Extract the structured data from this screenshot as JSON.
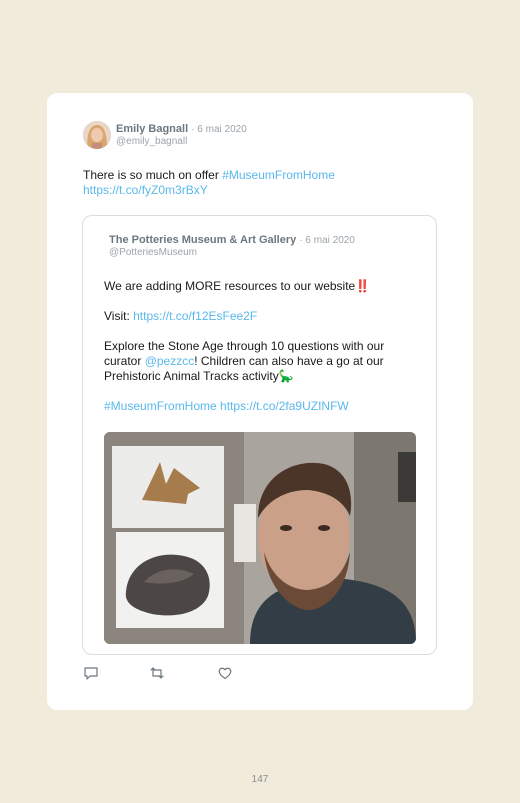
{
  "tweet": {
    "author_name": "Emily Bagnall",
    "date": "· 6 mai 2020",
    "handle": "@emily_bagnall",
    "text": "There is so much on offer ",
    "hashtag": "#MuseumFromHome",
    "link": "https://t.co/fyZ0m3rBxY"
  },
  "quote": {
    "author_name": "The Potteries Museum & Art Gallery",
    "date": "· 6 mai 2020",
    "handle": "@PotteriesMuseum",
    "line1": "We are adding MORE resources to our website",
    "line1_emoji": "‼️",
    "visit_label": "Visit: ",
    "visit_link": "https://t.co/f12EsFee2F",
    "explore_pre": "Explore the Stone Age through 10 questions with our curator ",
    "explore_mention": "@pezzcc",
    "explore_post": "! Children can also have a go at our Prehistoric Animal Tracks activity",
    "explore_emoji": "🦕",
    "hashtag": "#MuseumFromHome",
    "link2": "https://t.co/2fa9UZINFW"
  },
  "actions": {
    "reply_icon": "reply-icon",
    "retweet_icon": "retweet-icon",
    "like_icon": "heart-icon"
  },
  "page_number": "147",
  "colors": {
    "background": "#f1ebdc",
    "link": "#59b8ec",
    "name": "#6b7780",
    "muted": "#9aa4ab"
  }
}
